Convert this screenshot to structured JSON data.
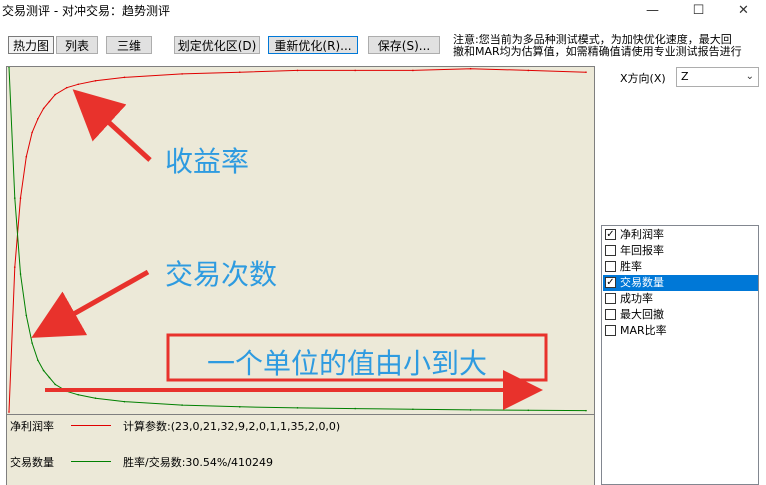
{
  "window": {
    "title": "交易测评 - 对冲交易：趋势测评",
    "minimize_glyph": "—",
    "maximize_glyph": "☐",
    "close_glyph": "✕"
  },
  "toolbar": {
    "tab_heatmap": "热力图",
    "tab_list": "列表",
    "tab_3d": "三维",
    "define_zone": "划定优化区(D)",
    "reoptimize": "重新优化(R)...",
    "save": "保存(S)..."
  },
  "notice": {
    "line1": "注意:您当前为多品种测试模式，为加快优化速度，最大回",
    "line2": "撤和MAR均为估算值，如需精确值请使用专业测试报告进行"
  },
  "x_direction": {
    "label": "X方向(X)",
    "value": "Z"
  },
  "metrics": [
    {
      "label": "净利润率",
      "checked": true,
      "selected": false
    },
    {
      "label": "年回报率",
      "checked": false,
      "selected": false
    },
    {
      "label": "胜率",
      "checked": false,
      "selected": false
    },
    {
      "label": "交易数量",
      "checked": true,
      "selected": true
    },
    {
      "label": "成功率",
      "checked": false,
      "selected": false
    },
    {
      "label": "最大回撤",
      "checked": false,
      "selected": false
    },
    {
      "label": "MAR比率",
      "checked": false,
      "selected": false
    }
  ],
  "legend": {
    "net_profit": {
      "name": "净利润率",
      "color": "#e00000"
    },
    "trade_count": {
      "name": "交易数量",
      "color": "#008000"
    },
    "calc_params": "计算参数:(23,0,21,32,9,2,0,1,1,35,2,0,0)",
    "win_rate": "胜率/交易数:30.54%/410249"
  },
  "annotations": {
    "profit": "收益率",
    "trades": "交易次数",
    "unit": "一个单位的值由小到大",
    "arrow_color": "#e8322c",
    "text_color": "#2e9be0"
  },
  "chart_data": {
    "type": "line",
    "title": "",
    "xlabel": "",
    "ylabel": "",
    "x": [
      0,
      1,
      2,
      3,
      4,
      5,
      6,
      7,
      8,
      10,
      12,
      15,
      20,
      30,
      40,
      50,
      60,
      70,
      80,
      90,
      100
    ],
    "series": [
      {
        "name": "净利润率",
        "color": "#e00000",
        "values": [
          0.0,
          0.42,
          0.62,
          0.74,
          0.81,
          0.85,
          0.88,
          0.9,
          0.92,
          0.94,
          0.95,
          0.96,
          0.97,
          0.98,
          0.985,
          0.99,
          0.99,
          0.99,
          0.995,
          0.99,
          0.985
        ]
      },
      {
        "name": "交易数量",
        "color": "#008000",
        "values": [
          1.0,
          0.62,
          0.4,
          0.28,
          0.2,
          0.15,
          0.12,
          0.1,
          0.08,
          0.06,
          0.05,
          0.04,
          0.03,
          0.02,
          0.015,
          0.012,
          0.01,
          0.008,
          0.006,
          0.005,
          0.004
        ]
      }
    ]
  }
}
